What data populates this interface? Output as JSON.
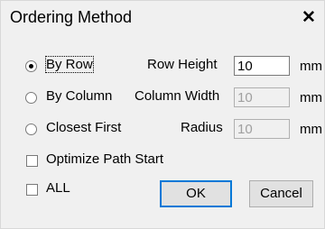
{
  "window": {
    "title": "Ordering Method",
    "close_glyph": "✕"
  },
  "options": {
    "by_row": {
      "label": "By Row",
      "selected": true
    },
    "by_column": {
      "label": "By Column",
      "selected": false
    },
    "closest_first": {
      "label": "Closest First",
      "selected": false
    }
  },
  "fields": {
    "row_height": {
      "label": "Row Height",
      "value": "10",
      "unit": "mm",
      "enabled": true
    },
    "column_width": {
      "label": "Column Width",
      "value": "10",
      "unit": "mm",
      "enabled": false
    },
    "radius": {
      "label": "Radius",
      "value": "10",
      "unit": "mm",
      "enabled": false
    }
  },
  "checkboxes": {
    "optimize_path_start": {
      "label": "Optimize Path Start",
      "checked": false
    },
    "all": {
      "label": "ALL",
      "checked": false
    }
  },
  "buttons": {
    "ok": "OK",
    "cancel": "Cancel"
  }
}
